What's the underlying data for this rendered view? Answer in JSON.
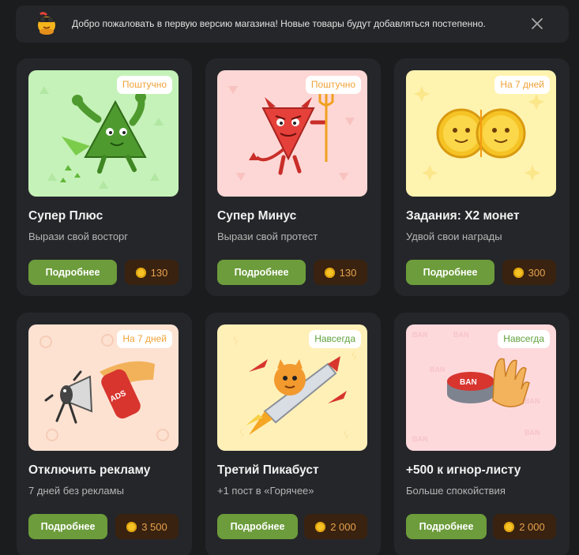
{
  "banner": {
    "text": "Добро пожаловать в первую версию магазина! Новые товары будут добавляться постепенно.",
    "mascot_icon": "pikabu-mascot-icon",
    "close_icon": "close-icon"
  },
  "colors": {
    "page_bg": "#1b1c1e",
    "card_bg": "#25262a",
    "button_green": "#6c9c3b",
    "price_bg": "#39220f",
    "price_text": "#e7a24e",
    "badge_orange": "#f0a238",
    "badge_green": "#5fa23c"
  },
  "products": [
    {
      "title": "Супер Плюс",
      "subtitle": "Вырази свой восторг",
      "badge": "Поштучно",
      "button": "Подробнее",
      "price": "130",
      "illustration": "super-plus-illustration"
    },
    {
      "title": "Супер Минус",
      "subtitle": "Вырази свой протест",
      "badge": "Поштучно",
      "button": "Подробнее",
      "price": "130",
      "illustration": "super-minus-illustration"
    },
    {
      "title": "Задания: Х2 монет",
      "subtitle": "Удвой свои награды",
      "badge": "На 7 дней",
      "button": "Подробнее",
      "price": "300",
      "illustration": "double-coins-illustration"
    },
    {
      "title": "Отключить рекламу",
      "subtitle": "7 дней без рекламы",
      "badge": "На 7 дней",
      "button": "Подробнее",
      "price": "3 500",
      "illustration": "no-ads-illustration"
    },
    {
      "title": "Третий Пикабуст",
      "subtitle": "+1 пост в «Горячее»",
      "badge": "Навсегда",
      "button": "Подробнее",
      "price": "2 000",
      "illustration": "pikaboost-illustration"
    },
    {
      "title": "+500 к игнор-листу",
      "subtitle": "Больше спокойствия",
      "badge": "Навсегда",
      "button": "Подробнее",
      "price": "2 000",
      "illustration": "ignore-list-illustration"
    }
  ]
}
